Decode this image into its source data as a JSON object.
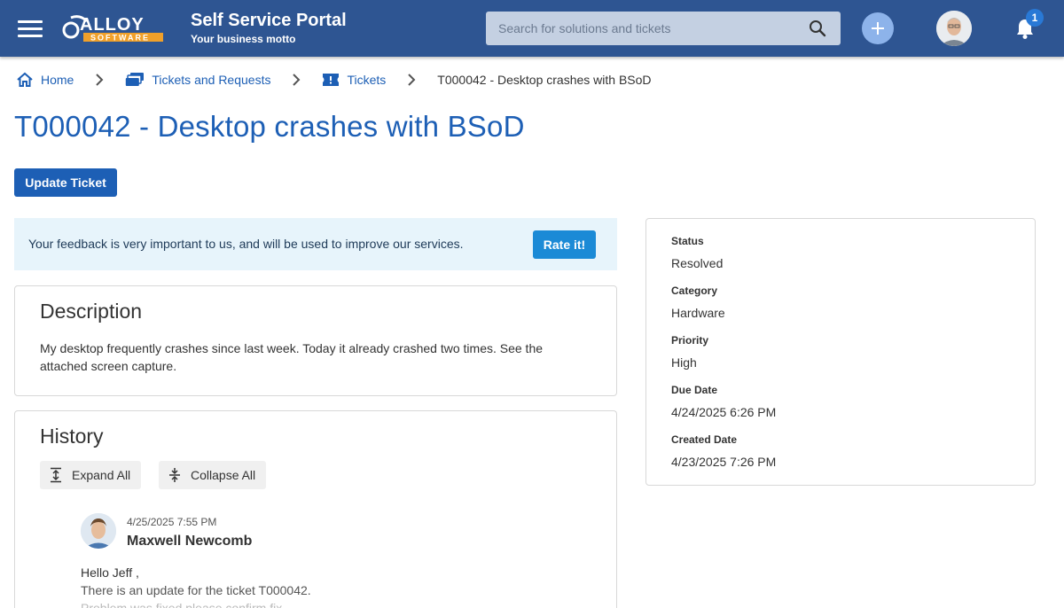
{
  "header": {
    "logo_text": "ALLOY",
    "logo_sub": "SOFTWARE",
    "title": "Self Service Portal",
    "motto": "Your business motto",
    "search_placeholder": "Search for solutions and tickets",
    "notification_count": "1",
    "icons": [
      "menu-icon",
      "search-icon",
      "plus-icon",
      "bell-icon"
    ]
  },
  "breadcrumb": {
    "home": "Home",
    "tickets_requests": "Tickets and Requests",
    "tickets": "Tickets",
    "current": "T000042 - Desktop crashes with BSoD"
  },
  "page": {
    "title": "T000042 - Desktop crashes with BSoD",
    "update_label": "Update Ticket"
  },
  "feedback": {
    "text": "Your feedback is very important to us, and will be used to improve our services.",
    "rate_label": "Rate it!"
  },
  "description": {
    "title": "Description",
    "text": "My desktop frequently crashes since last week. Today it already crashed two times. See the attached screen capture."
  },
  "history": {
    "title": "History",
    "expand_label": "Expand All",
    "collapse_label": "Collapse All",
    "entries": [
      {
        "date": "4/25/2025 7:55 PM",
        "author": "Maxwell Newcomb",
        "line1": "Hello Jeff ,",
        "line2": "There is an update for the ticket T000042.",
        "line3": "Problem was fixed please confirm fix"
      }
    ]
  },
  "details": {
    "status_label": "Status",
    "status_value": "Resolved",
    "category_label": "Category",
    "category_value": "Hardware",
    "priority_label": "Priority",
    "priority_value": "High",
    "due_label": "Due Date",
    "due_value": "4/24/2025 6:26 PM",
    "created_label": "Created Date",
    "created_value": "4/23/2025 7:26 PM"
  },
  "colors": {
    "header_bg": "#2e5592",
    "link_blue": "#1d5fb5",
    "rate_blue": "#1b8ad6",
    "feedback_bg": "#e7f4fb",
    "logo_orange": "#f0a02a"
  }
}
